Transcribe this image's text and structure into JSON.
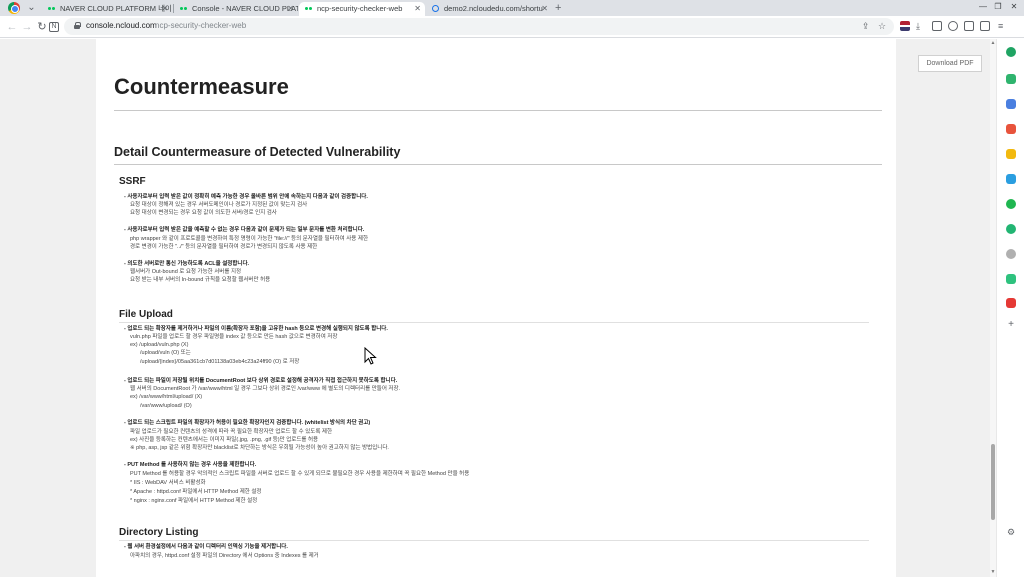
{
  "browser": {
    "tabs": [
      {
        "title": "NAVER CLOUD PLATFORM 네이",
        "favicon": "ncp-icon",
        "active": false
      },
      {
        "title": "Console - NAVER CLOUD PLATF",
        "favicon": "ncp-icon",
        "active": false
      },
      {
        "title": "ncp-security-checker-web",
        "favicon": "ncp-icon",
        "active": true
      },
      {
        "title": "demo2.ncloudedu.com/shortu",
        "favicon": "globe-icon",
        "active": false
      }
    ],
    "close_glyph": "✕",
    "new_tab": "+",
    "window_controls": {
      "minimize": "—",
      "restore": "❐",
      "close": "✕"
    },
    "url_host": "console.ncloud.com",
    "url_path": "ncp-security-checker-web"
  },
  "page": {
    "download_label": "Download PDF",
    "title": "Countermeasure",
    "section_title": "Detail Countermeasure of Detected Vulnerability",
    "subsections": [
      {
        "title": "SSRF",
        "lines": [
          {
            "text": "- 사용자로부터 입력 받은 값이 정확히 예측 가능한 경우 올바른 범위 안에 속하는지 다음과 같이 검증합니다.",
            "bold": true,
            "indent": 0
          },
          {
            "text": "요청 대상이 정해져 있는 경우 서버도메인이나 경로가 지정된 값이 맞는지 검사",
            "bold": false,
            "indent": 1
          },
          {
            "text": "요청 대상이 변경되는 경우 요청 값이 의도한 서버/경로 인지 검사",
            "bold": false,
            "indent": 1
          },
          {
            "text": "",
            "bold": false,
            "indent": 0
          },
          {
            "text": "- 사용자로부터 입력 받은 값을 예측할 수 없는 경우 다음과 같이 문제가 되는 일부 문자를 변환 처리합니다.",
            "bold": true,
            "indent": 0
          },
          {
            "text": "php wrapper 와 같이 프로토콜을 변경하여 특정 명령이 가능한 \"file://\" 등의 문자열을 필터하여 사용 제한",
            "bold": false,
            "indent": 1
          },
          {
            "text": "경로 변경이 가능한 \"../\" 등의 문자열을 필터하여 경로가 변경되지 않도록 사용 제한",
            "bold": false,
            "indent": 1
          },
          {
            "text": "",
            "bold": false,
            "indent": 0
          },
          {
            "text": "- 의도한 서버로만 통신 가능하도록 ACL을 설정합니다.",
            "bold": true,
            "indent": 0
          },
          {
            "text": "웹서버가 Out-bound 로 요청 가능한 서버를 지정",
            "bold": false,
            "indent": 1
          },
          {
            "text": "요청 받는 내부 서버의 In-bound 규칙을 요청할 웹서버만 허용",
            "bold": false,
            "indent": 1
          }
        ]
      },
      {
        "title": "File Upload",
        "lines": [
          {
            "text": "- 업로드 되는 확장자를 제거하거나 파일의 이름(확장자 포함)을 고유한 hash 등으로 변경해 실행되지 않도록 합니다.",
            "bold": true,
            "indent": 0
          },
          {
            "text": "vuln.php 파일을 업로드 할 경우 파일명을 index 값 등으로 만든 hash 값으로 변경하여 저장",
            "bold": false,
            "indent": 1
          },
          {
            "text": "ex) /upload/vuln.php (X)",
            "bold": false,
            "indent": 1
          },
          {
            "text": "/upload/vuln (O) 또는",
            "bold": false,
            "indent": 2
          },
          {
            "text": "/upload/{index}/05aa361cb7d01138a03eb4c23a24ff90 (O) 로 저장",
            "bold": false,
            "indent": 2
          },
          {
            "text": "",
            "bold": false,
            "indent": 0
          },
          {
            "text": "- 업로드 되는 파일이 저장될 위치를 DocumentRoot 보다 상위 경로로 설정해 공격자가 직접 접근하지 못하도록 합니다.",
            "bold": true,
            "indent": 0
          },
          {
            "text": "웹 서버의 DocumentRoot 가 /var/www/html 일 경우 그보다 상위 경로인 /var/www 에 별도의 디렉터리를 만들어 저장.",
            "bold": false,
            "indent": 1
          },
          {
            "text": "ex) /var/www/html/upload/ (X)",
            "bold": false,
            "indent": 1
          },
          {
            "text": "/var/www/upload/ (O)",
            "bold": false,
            "indent": 2
          },
          {
            "text": "",
            "bold": false,
            "indent": 0
          },
          {
            "text": "- 업로드 되는 스크립트 파일의 확장자가 허용이 필요한 확장자인지 검증합니다. (whitelist 방식의 차단 권고)",
            "bold": true,
            "indent": 0
          },
          {
            "text": "파일 업로드가 필요한 컨텐츠의 성격에 따라 꼭 필요한 확장자만 업로드 할 수 있도록 제한",
            "bold": false,
            "indent": 1
          },
          {
            "text": "ex) 사진을 등록하는 컨텐츠에서는 이미지 파일(.jpg, .png, .gif 등)만 업로드를 허용",
            "bold": false,
            "indent": 1
          },
          {
            "text": "※ php, asp, jsp 같은 위험 확장자만 blacklist로 차단하는 방식은 우회될 가능성이 높아 권고하지 않는 방법입니다.",
            "bold": false,
            "indent": 1
          },
          {
            "text": "",
            "bold": false,
            "indent": 0
          },
          {
            "text": "- PUT Method 를 사용하지 않는 경우 사용을 제한합니다.",
            "bold": true,
            "indent": 0
          },
          {
            "text": "PUT Method 를 허용할 경우 악의적인 스크립트 파일을 서버로 업로드 할 수 있게 되므로 불필요한 경우 사용을 제한하며 꼭 필요한 Method 만을 허용",
            "bold": false,
            "indent": 1
          },
          {
            "text": "* IIS : WebDAV 서비스 비활성화",
            "bold": false,
            "indent": 1
          },
          {
            "text": "* Apache : httpd.conf 파일에서 HTTP Method 제한 설정",
            "bold": false,
            "indent": 1
          },
          {
            "text": "* nginx : nginx.conf 파일에서 HTTP Method 제한 설정",
            "bold": false,
            "indent": 1
          }
        ]
      },
      {
        "title": "Directory Listing",
        "lines": [
          {
            "text": "- 웹 서버 환경설정에서 다음과 같이 디렉터리 인덱싱 기능을 제거합니다.",
            "bold": true,
            "indent": 0
          },
          {
            "text": "아파치의 경우, httpd.conf 설정 파일의 Directory 에서 Options 중 Indexes 를 제거",
            "bold": false,
            "indent": 1
          }
        ]
      }
    ]
  }
}
